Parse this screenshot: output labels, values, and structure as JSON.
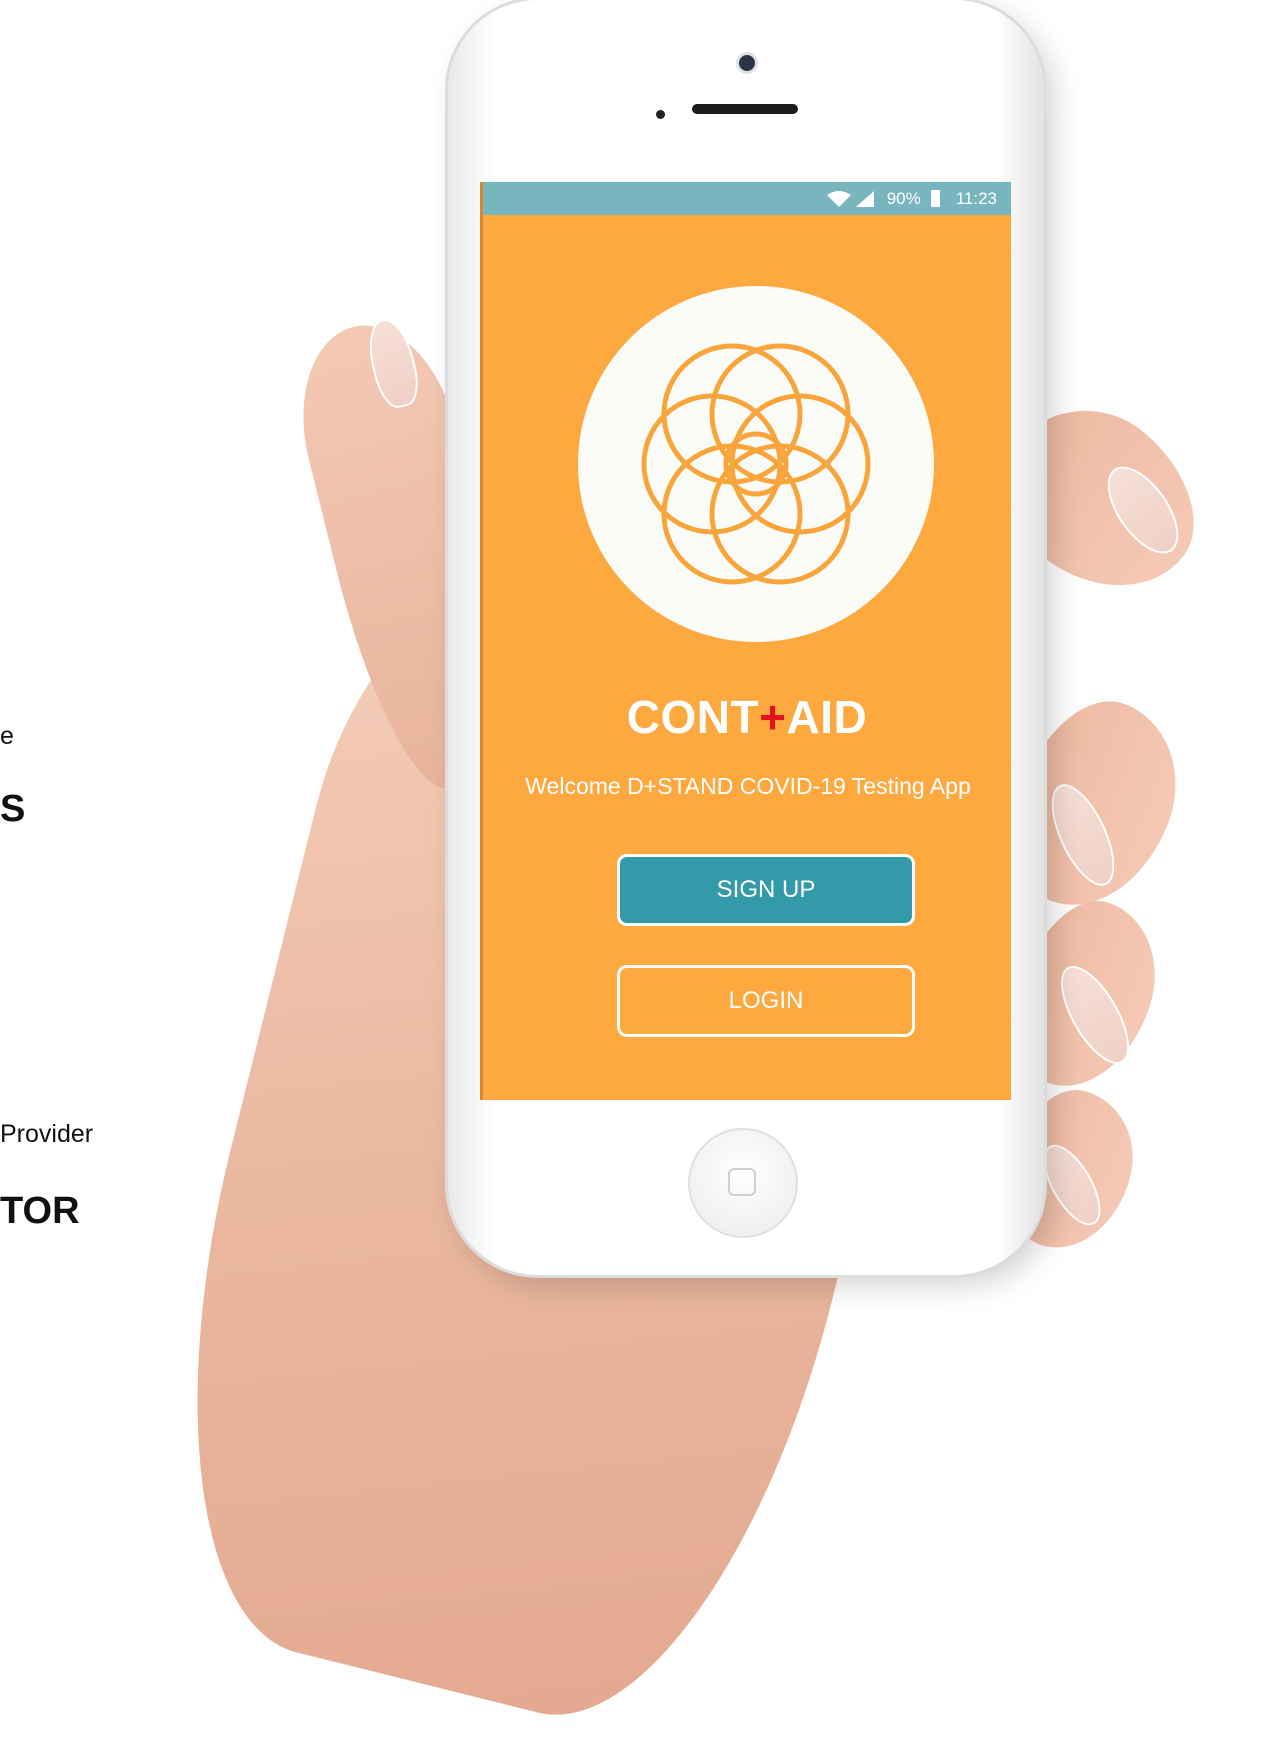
{
  "side_text": {
    "line1": "e",
    "line2": "S",
    "line3": "Provider",
    "line4": "TOR"
  },
  "status_bar": {
    "wifi_icon": "wifi-icon",
    "signal_icon": "signal-icon",
    "battery_percent": "90%",
    "battery_icon": "battery-icon",
    "time": "11:23"
  },
  "app": {
    "logo_icon": "flower-of-life-logo-icon",
    "title_left": "CONT",
    "title_plus": "+",
    "title_right": "AID",
    "welcome_text": "Welcome D+STAND  COVID-19 Testing App",
    "signup_label": "SIGN UP",
    "login_label": "LOGIN"
  },
  "colors": {
    "screen_background": "#fda93f",
    "status_bar": "#78b6bf",
    "signup_button": "#339aa9",
    "plus_accent": "#e2141b",
    "logo_circle": "#fbfbf7"
  }
}
